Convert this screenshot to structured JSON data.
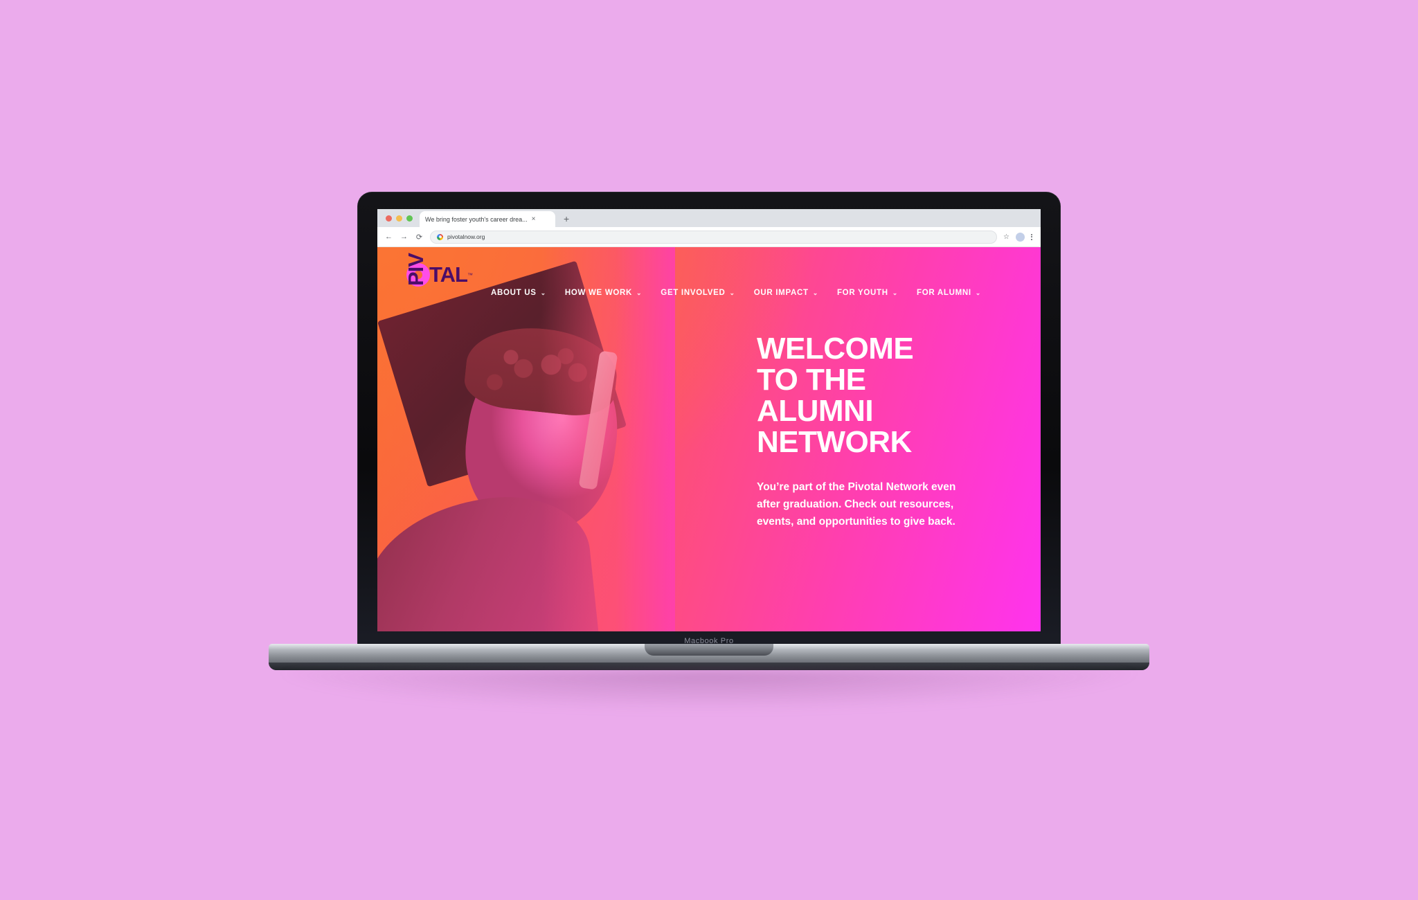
{
  "device": {
    "model_label": "Macbook Pro"
  },
  "browser": {
    "tab": {
      "title": "We bring foster youth's career drea...",
      "close_label": "×",
      "new_tab_label": "+"
    },
    "toolbar": {
      "back_icon": "←",
      "forward_icon": "→",
      "reload_icon": "⟳",
      "url": "pivotalnow.org",
      "favicon": "google-g-icon",
      "bookmark_icon": "☆",
      "profile_icon": "avatar",
      "menu_icon": "three-dot-menu"
    }
  },
  "site": {
    "logo": {
      "brand": "PIVOTAL",
      "letters_vertical": "PIV",
      "letters_horizontal": "TAL",
      "trademark": "™",
      "color_dark": "#4b0d68",
      "color_accent": "#ff4de8"
    },
    "nav": [
      {
        "label": "ABOUT US",
        "has_dropdown": true
      },
      {
        "label": "HOW WE WORK",
        "has_dropdown": true
      },
      {
        "label": "GET INVOLVED",
        "has_dropdown": true
      },
      {
        "label": "OUR IMPACT",
        "has_dropdown": true
      },
      {
        "label": "FOR YOUTH",
        "has_dropdown": true
      },
      {
        "label": "FOR ALUMNI",
        "has_dropdown": true
      }
    ],
    "chevron_glyph": "⌄",
    "hero": {
      "headline_lines": [
        "WELCOME",
        "TO THE",
        "ALUMNI",
        "NETWORK"
      ],
      "body": "You’re part of the Pivotal Network even after graduation. Check out resources, events, and opportunities to give back.",
      "image_alt": "smiling graduate wearing mortarboard cap with tassel",
      "gradient_start": "#fa6b35",
      "gradient_end": "#ff33ee"
    }
  },
  "page_background": "#ebabec"
}
